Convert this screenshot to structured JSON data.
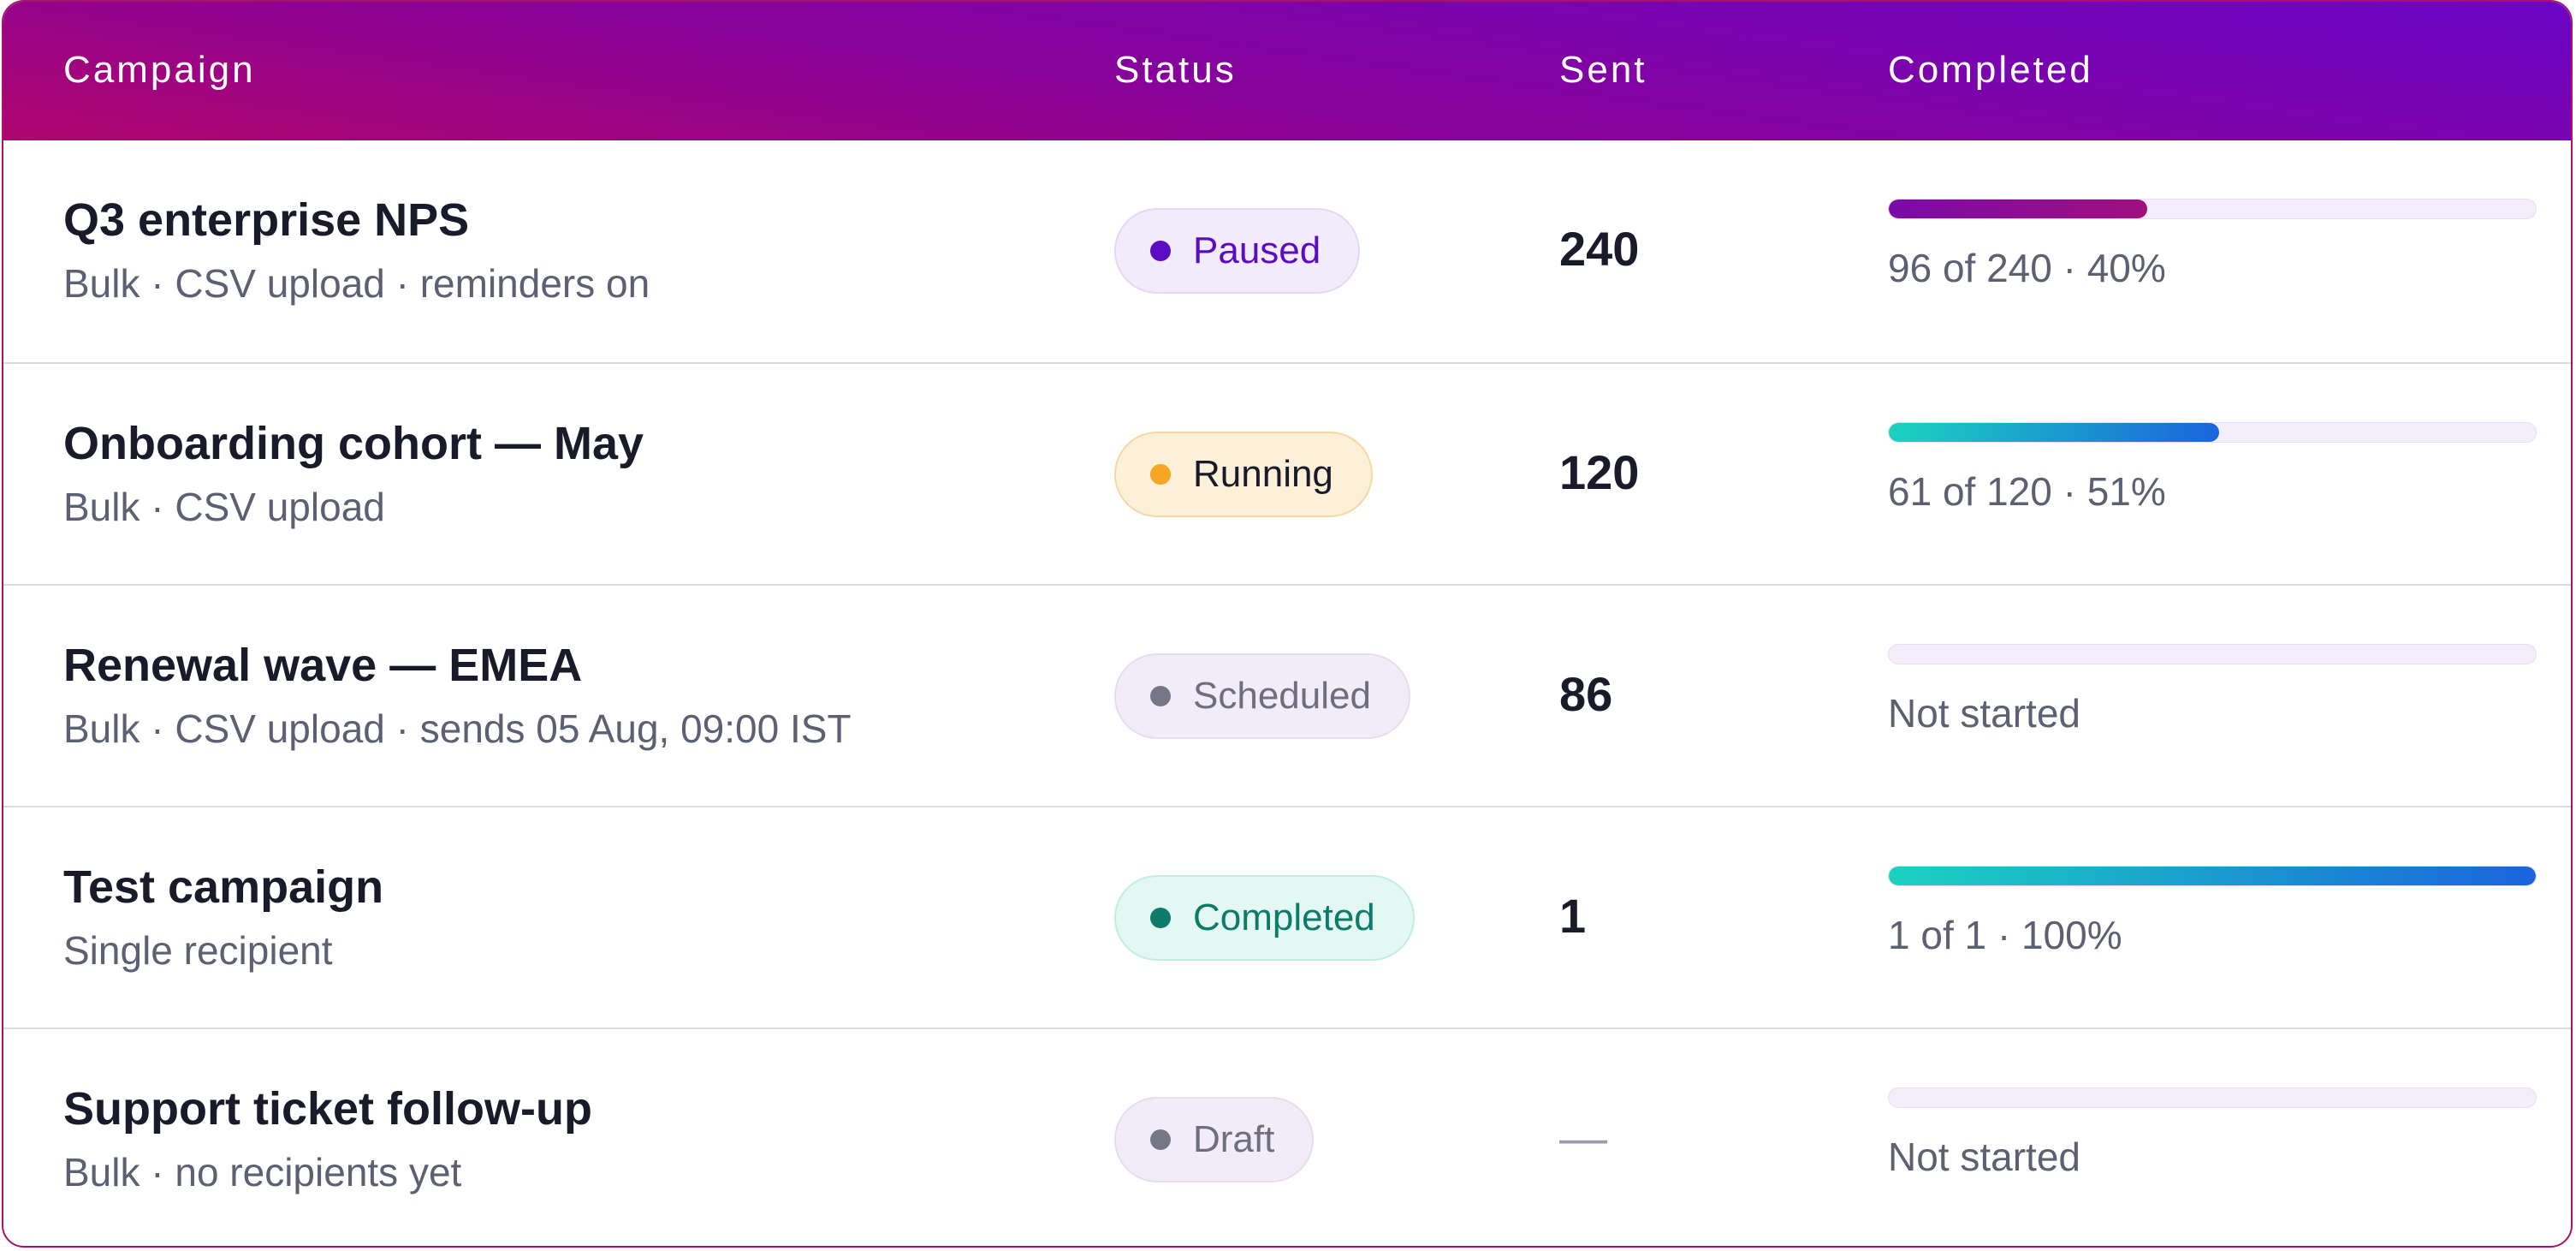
{
  "header": {
    "campaign": "Campaign",
    "status": "Status",
    "sent": "Sent",
    "completed": "Completed"
  },
  "colors": {
    "header_gradient_start": "#b0066e",
    "header_gradient_end": "#6a05c6",
    "progress_purple": "#7a0aa8",
    "progress_teal_start": "#1bd3c0",
    "progress_teal_end": "#1a64dc"
  },
  "rows": [
    {
      "name": "Q3 enterprise NPS",
      "meta": "Bulk · CSV upload · reminders on",
      "status": "Paused",
      "status_colors": {
        "bg": "#f2ebfb",
        "border": "#e4d8f6",
        "text": "#5b0cc2",
        "dot": "#5b0cc2"
      },
      "sent": "240",
      "progress": 0.4,
      "progress_style": "purple",
      "progress_text": "96 of 240 · 40%"
    },
    {
      "name": "Onboarding cohort — May",
      "meta": "Bulk · CSV upload",
      "status": "Running",
      "status_colors": {
        "bg": "#fdf0d8",
        "border": "#f5d9a2",
        "text": "#1a1b2a",
        "dot": "#f6a623"
      },
      "sent": "120",
      "progress": 0.51,
      "progress_style": "teal",
      "progress_text": "61 of 120 · 51%"
    },
    {
      "name": "Renewal wave — EMEA",
      "meta": "Bulk · CSV upload · sends 05 Aug, 09:00 IST",
      "status": "Scheduled",
      "status_colors": {
        "bg": "#f2ecf9",
        "border": "#e6deef",
        "text": "#6d6f80",
        "dot": "#757787"
      },
      "sent": "86",
      "progress": 0,
      "progress_style": "none",
      "progress_text": "Not started"
    },
    {
      "name": "Test campaign",
      "meta": "Single recipient",
      "status": "Completed",
      "status_colors": {
        "bg": "#e3f8f3",
        "border": "#c3ece2",
        "text": "#0d7a6a",
        "dot": "#0d7a6a"
      },
      "sent": "1",
      "progress": 1.0,
      "progress_style": "teal",
      "progress_text": "1 of 1 · 100%"
    },
    {
      "name": "Support ticket follow-up",
      "meta": "Bulk · no recipients yet",
      "status": "Draft",
      "status_colors": {
        "bg": "#f2ecf9",
        "border": "#e6deef",
        "text": "#6d6f80",
        "dot": "#757787"
      },
      "sent": "—",
      "sent_muted": true,
      "progress": 0,
      "progress_style": "none",
      "progress_text": "Not started"
    }
  ]
}
